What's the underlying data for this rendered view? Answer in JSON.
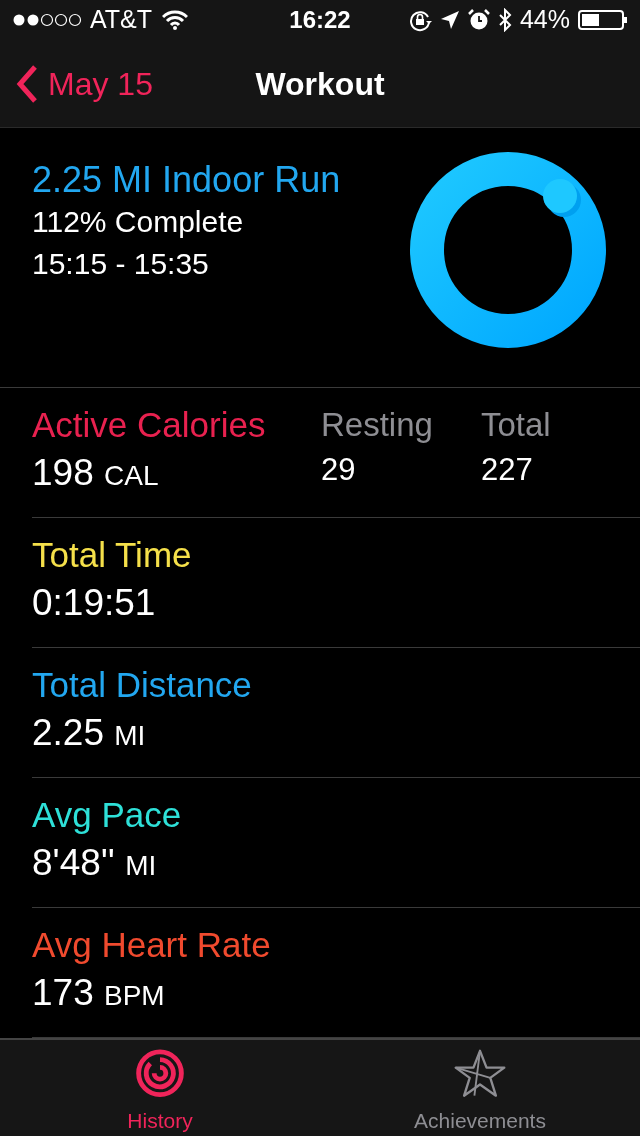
{
  "status_bar": {
    "carrier": "AT&T",
    "time": "16:22",
    "battery": "44%"
  },
  "nav": {
    "back": "May 15",
    "title": "Workout"
  },
  "workout": {
    "title": "2.25 MI Indoor Run",
    "complete": "112% Complete",
    "time_range": "15:15 - 15:35"
  },
  "metrics": [
    {
      "label": "Active Calories",
      "color": "#e8214f",
      "value": "198",
      "unit": "CAL",
      "extras": [
        {
          "label": "Resting",
          "value": "29"
        },
        {
          "label": "Total",
          "value": "227"
        }
      ]
    },
    {
      "label": "Total Time",
      "color": "#f5e04a",
      "value": "0:19:51"
    },
    {
      "label": "Total Distance",
      "color": "#22a7f0",
      "value": "2.25",
      "unit": "MI"
    },
    {
      "label": "Avg Pace",
      "color": "#2ee0d8",
      "value": "8'48''",
      "unit": "MI"
    },
    {
      "label": "Avg Heart Rate",
      "color": "#f04a2e",
      "value": "173",
      "unit": "BPM"
    }
  ],
  "tabs": [
    {
      "label": "History",
      "selected": true,
      "kind": "history"
    },
    {
      "label": "Achievements",
      "selected": false,
      "kind": "achievements"
    }
  ]
}
